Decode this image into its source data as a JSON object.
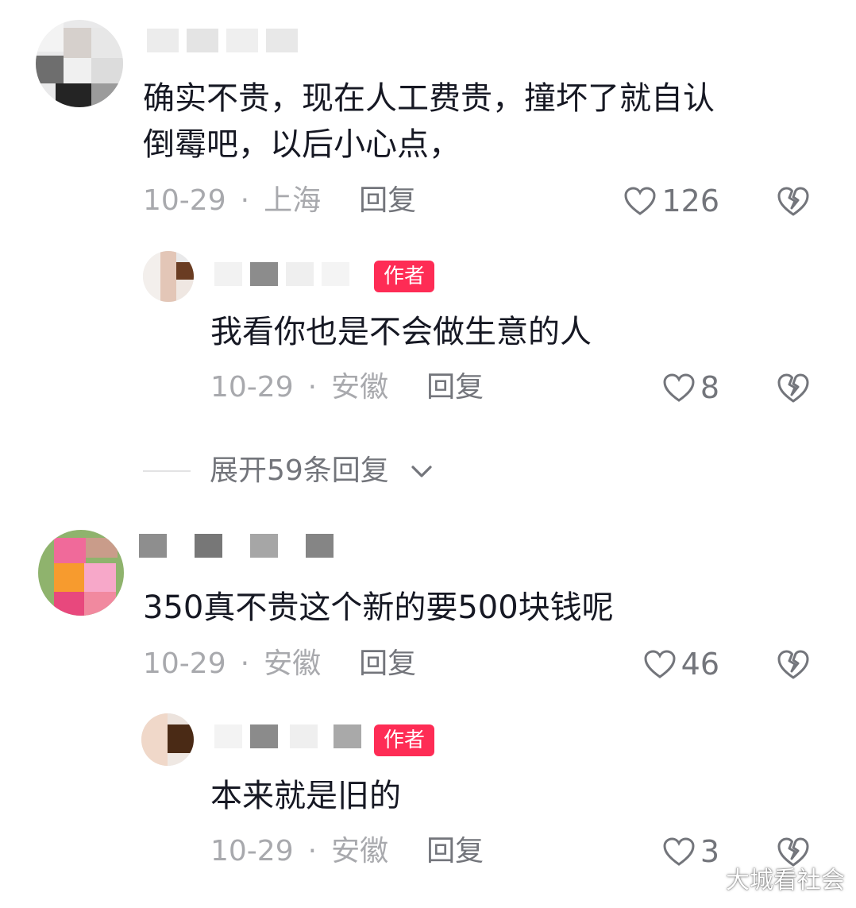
{
  "comments": [
    {
      "text": "确实不贵，现在人工费贵，撞坏了就自认\n倒霉吧，以后小心点，",
      "date": "10-29",
      "location": "上海",
      "reply_label": "回复",
      "likes": "126"
    },
    {
      "badge": "作者",
      "text": "我看你也是不会做生意的人",
      "date": "10-29",
      "location": "安徽",
      "reply_label": "回复",
      "likes": "8"
    },
    {
      "text": "350真不贵这个新的要500块钱呢",
      "date": "10-29",
      "location": "安徽",
      "reply_label": "回复",
      "likes": "46"
    },
    {
      "badge": "作者",
      "text": "本来就是旧的",
      "date": "10-29",
      "location": "安徽",
      "reply_label": "回复",
      "likes": "3"
    }
  ],
  "expand_replies": {
    "label": "展开59条回复"
  },
  "icons": {
    "like": "heart-outline-icon",
    "dislike": "broken-heart-icon",
    "expand": "chevron-down-icon"
  },
  "colors": {
    "text": "#161823",
    "meta": "#a8a9ad",
    "action": "#73757b",
    "author_badge": "#fe2c55"
  },
  "watermark": "大城看社会"
}
